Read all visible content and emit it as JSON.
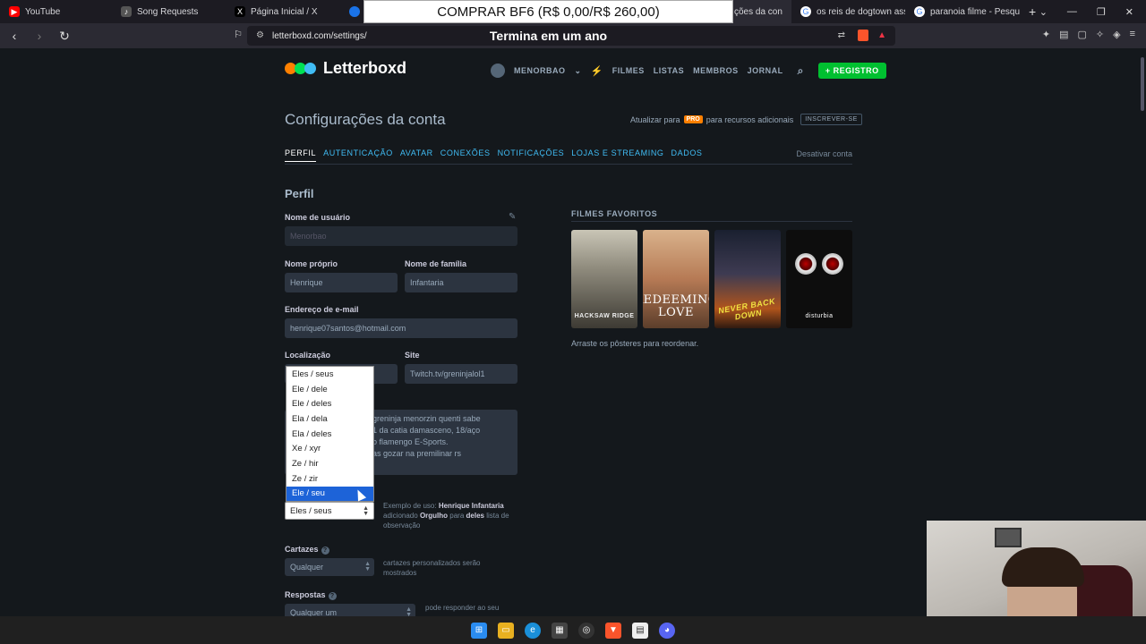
{
  "browser": {
    "tabs": [
      {
        "label": "YouTube",
        "icon": "youtube-icon",
        "color": "#ff0000"
      },
      {
        "label": "Song Requests",
        "icon": "song-icon",
        "color": "#555555"
      },
      {
        "label": "Página Inicial / X",
        "icon": "x-icon",
        "color": "#000000"
      },
      {
        "label": "",
        "icon": "chrome-icon",
        "color": "#1a73e8"
      },
      {
        "label": "ções da con",
        "icon": "letterboxd-icon",
        "color": "#2b2a33",
        "active": true
      },
      {
        "label": "os reis de dogtown assist",
        "icon": "google-icon",
        "color": "#4285f4"
      },
      {
        "label": "paranoia filme - Pesquisa",
        "icon": "google-icon",
        "color": "#4285f4"
      }
    ],
    "url": "letterboxd.com/settings/"
  },
  "overlays": {
    "banner": "COMPRAR BF6 (R$ 0,00/R$ 260,00)",
    "timer": "Termina em um ano"
  },
  "site": {
    "logo": "Letterboxd",
    "logo_colors": [
      "#ff8000",
      "#00e054",
      "#40bcf4"
    ],
    "nav": {
      "user": "MENORBAO",
      "films": "FILMES",
      "lists": "LISTAS",
      "members": "MEMBROS",
      "journal": "JORNAL",
      "register": "+ REGISTRO"
    }
  },
  "settings": {
    "title": "Configurações da conta",
    "upgrade_prefix": "Atualizar para",
    "pro_badge": "PRO",
    "upgrade_suffix": "para recursos adicionais",
    "subscribe": "INSCREVER-SE",
    "tabs": [
      "PERFIL",
      "AUTENTICAÇÃO",
      "AVATAR",
      "CONEXÕES",
      "NOTIFICAÇÕES",
      "LOJAS E STREAMING",
      "DADOS"
    ],
    "deactivate": "Desativar conta"
  },
  "profile": {
    "section_title": "Perfil",
    "username_label": "Nome de usuário",
    "username_value": "Menorbao",
    "first_name_label": "Nome próprio",
    "first_name_value": "Henrique",
    "last_name_label": "Nome de família",
    "last_name_value": "Infantaria",
    "email_label": "Endereço de e-mail",
    "email_value": "henrique07santos@hotmail.com",
    "location_label": "Localização",
    "site_label": "Site",
    "site_value": "Twitch.tv/greninjalol1",
    "bio_lines": [
      "greninja menorzin quenti sabe",
      "1 da catia damasceno, 18/aço",
      "o flamengo E-Sports.",
      "as gozar na premilinar rs"
    ],
    "pronoun_example_prefix": "Exemplo de uso:",
    "pronoun_example_name": "Henrique Infantaria",
    "pronoun_example_mid": "adicionado",
    "pronoun_example_item": "Orgulho",
    "pronoun_example_to": "para",
    "pronoun_example_pronoun": "deles",
    "pronoun_example_end": "lista de observação",
    "posters_label": "Cartazes",
    "posters_value": "Qualquer",
    "posters_note_1": "cartazes personalizados serão",
    "posters_note_2": "mostrados",
    "replies_label": "Respostas",
    "replies_value": "Qualquer um",
    "replies_note": "pode responder ao seu"
  },
  "pronoun_dropdown": {
    "options": [
      "Eles / seus",
      "Ele / dele",
      "Ele / deles",
      "Ela / dela",
      "Ela / deles",
      "Xe / xyr",
      "Ze / hir",
      "Ze / zir",
      "Ele / seu"
    ],
    "highlighted": "Ele / seu",
    "current": "Eles / seus"
  },
  "favorites": {
    "title": "FILMES FAVORITOS",
    "films": [
      {
        "title": "HACKSAW RIDGE"
      },
      {
        "title": "REDEEMING LOVE"
      },
      {
        "title": "NEVER BACK DOWN"
      },
      {
        "title": "disturbia"
      }
    ],
    "note": "Arraste os pôsteres para reordenar."
  }
}
